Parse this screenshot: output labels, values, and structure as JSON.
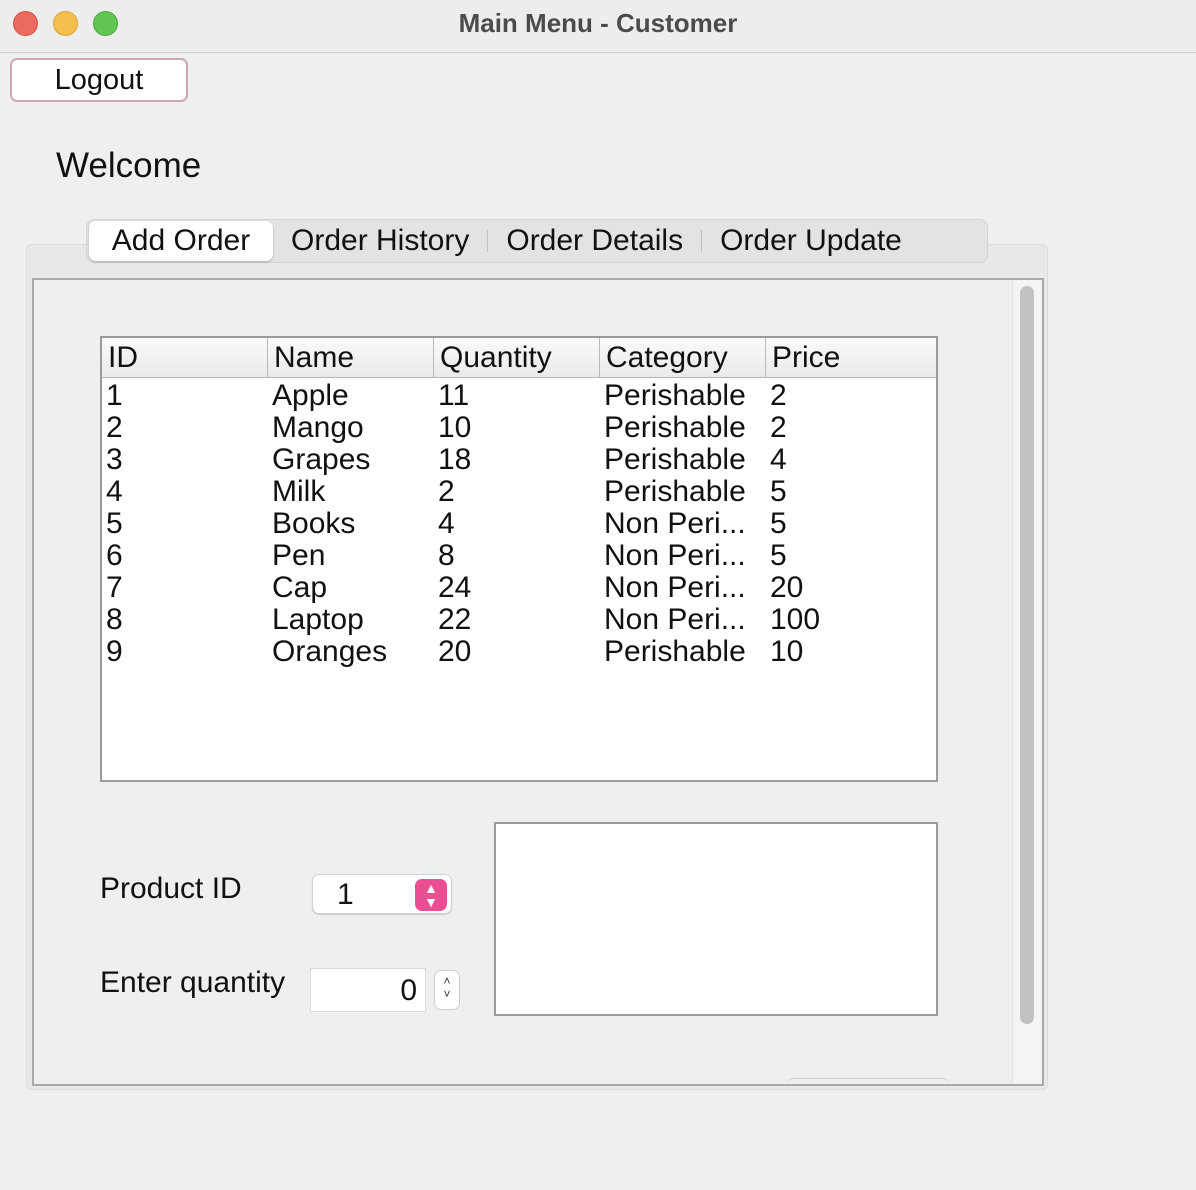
{
  "window": {
    "title": "Main Menu - Customer"
  },
  "header": {
    "logout_label": "Logout",
    "welcome": "Welcome"
  },
  "tabs": [
    {
      "label": "Add Order",
      "active": true
    },
    {
      "label": "Order History",
      "active": false
    },
    {
      "label": "Order Details",
      "active": false
    },
    {
      "label": "Order Update",
      "active": false
    }
  ],
  "table": {
    "columns": [
      "ID",
      "Name",
      "Quantity",
      "Category",
      "Price"
    ],
    "rows": [
      [
        "1",
        "Apple",
        "11",
        "Perishable",
        "2"
      ],
      [
        "2",
        "Mango",
        "10",
        "Perishable",
        "2"
      ],
      [
        "3",
        "Grapes",
        "18",
        "Perishable",
        "4"
      ],
      [
        "4",
        "Milk",
        "2",
        "Perishable",
        "5"
      ],
      [
        "5",
        "Books",
        "4",
        "Non Peri...",
        "5"
      ],
      [
        "6",
        "Pen",
        "8",
        "Non Peri...",
        "5"
      ],
      [
        "7",
        "Cap",
        "24",
        "Non Peri...",
        "20"
      ],
      [
        "8",
        "Laptop",
        "22",
        "Non Peri...",
        "100"
      ],
      [
        "9",
        "Oranges",
        "20",
        "Perishable",
        "10"
      ]
    ]
  },
  "form": {
    "product_id_label": "Product ID",
    "product_id_value": "1",
    "quantity_label": "Enter quantity",
    "quantity_value": "0",
    "details_text": ""
  },
  "colors": {
    "accent": "#ea4f93",
    "traffic_red": "#ed6a5e",
    "traffic_yellow": "#f5bf4f",
    "traffic_green": "#61c554"
  },
  "icons": [
    "close-icon",
    "minimize-icon",
    "zoom-icon",
    "chevron-updown-icon"
  ]
}
